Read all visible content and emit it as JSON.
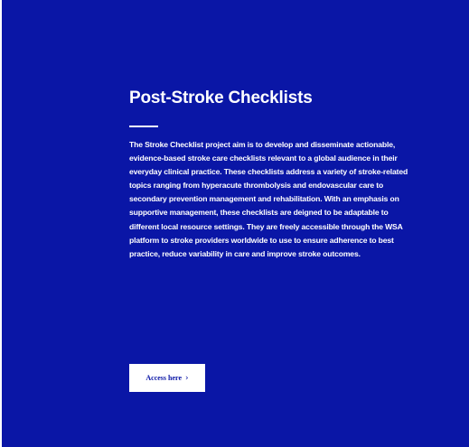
{
  "colors": {
    "panel_background": "#0a16a6",
    "text": "#ffffff",
    "button_background": "#ffffff",
    "button_text": "#0a16a6"
  },
  "card": {
    "title": "Post-Stroke Checklists",
    "body": "The Stroke Checklist project aim is to develop and disseminate actionable, evidence-based stroke care checklists relevant to a global audience in their everyday clinical practice. These checklists address a variety of stroke-related topics ranging from hyperacute thrombolysis and endovascular care to secondary prevention management and rehabilitation. With an emphasis on supportive management, these checklists are deigned to be adaptable to different local resource settings. They are freely accessible through the WSA platform to stroke providers worldwide to use to ensure adherence to best practice, reduce variability in care and improve stroke outcomes.",
    "cta_label": "Access here",
    "cta_icon": "chevron-right-icon",
    "cta_icon_glyph": "›"
  }
}
